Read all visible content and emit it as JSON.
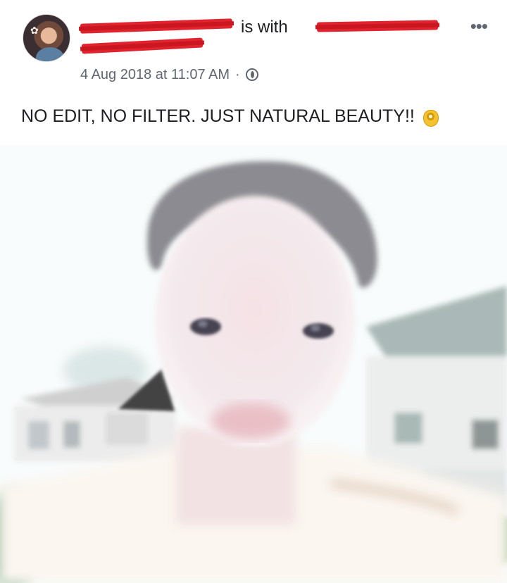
{
  "post": {
    "header": {
      "connector_text": "is with",
      "timestamp": "4 Aug 2018 at 11:07 AM",
      "separator": "·",
      "privacy_icon": "globe-icon",
      "more_label": "•••"
    },
    "caption": {
      "text": "NO EDIT, NO FILTER. JUST NATURAL BEAUTY!!",
      "emoji_icon": "ok-hand-icon"
    },
    "colors": {
      "redaction": "#e0232e",
      "timestamp_text": "#606770",
      "body_text": "#1c1e21"
    }
  }
}
